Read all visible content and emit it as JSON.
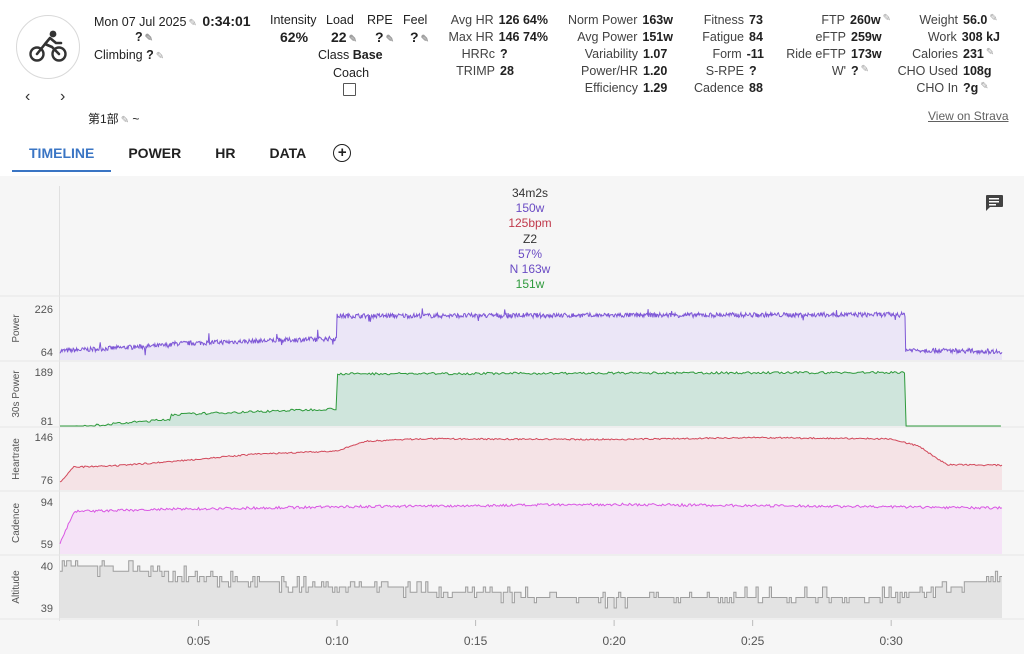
{
  "activity": {
    "date": "Mon 07 Jul 2025",
    "duration": "0:34:01",
    "name_value": "?",
    "climbing_label": "Climbing",
    "climbing_value": "?",
    "name_sub": "第1部",
    "name_sub_suffix": "~",
    "icon": "cycling-icon"
  },
  "metrics": {
    "intensity_label": "Intensity",
    "intensity": "62%",
    "load_label": "Load",
    "load": "22",
    "rpe_label": "RPE",
    "rpe": "?",
    "feel_label": "Feel",
    "feel": "?",
    "class_label": "Class",
    "class_value": "Base",
    "coach_label": "Coach"
  },
  "hr_stats": [
    {
      "label": "Avg HR",
      "value": "126  64%"
    },
    {
      "label": "Max HR",
      "value": "146  74%"
    },
    {
      "label": "HRRc",
      "value": "?"
    },
    {
      "label": "TRIMP",
      "value": "28"
    }
  ],
  "power_stats": [
    {
      "label": "Norm Power",
      "value": "163w"
    },
    {
      "label": "Avg Power",
      "value": "151w"
    },
    {
      "label": "Variability",
      "value": "1.07"
    },
    {
      "label": "Power/HR",
      "value": "1.20"
    },
    {
      "label": "Efficiency",
      "value": "1.29"
    }
  ],
  "fitness_stats": [
    {
      "label": "Fitness",
      "value": "73"
    },
    {
      "label": "Fatigue",
      "value": "84"
    },
    {
      "label": "Form",
      "value": "-11"
    },
    {
      "label": "S-RPE",
      "value": "?"
    },
    {
      "label": "Cadence",
      "value": "88"
    }
  ],
  "ftp_stats": [
    {
      "label": "FTP",
      "value": "260w"
    },
    {
      "label": "eFTP",
      "value": "259w"
    },
    {
      "label": "Ride eFTP",
      "value": "173w"
    },
    {
      "label": "W'",
      "value": "?"
    }
  ],
  "body_stats": [
    {
      "label": "Weight",
      "value": "56.0"
    },
    {
      "label": "Work",
      "value": "308 kJ"
    },
    {
      "label": "Calories",
      "value": "231"
    },
    {
      "label": "CHO Used",
      "value": "108g"
    },
    {
      "label": "CHO In",
      "value": "?g"
    }
  ],
  "strava_link": "View on Strava",
  "tabs": [
    {
      "label": "TIMELINE",
      "active": true
    },
    {
      "label": "POWER",
      "active": false
    },
    {
      "label": "HR",
      "active": false
    },
    {
      "label": "DATA",
      "active": false
    }
  ],
  "add_tab": "+",
  "summary": {
    "duration": "34m2s",
    "power": "150w",
    "hr": "125bpm",
    "zone": "Z2",
    "percent": "57%",
    "norm_power": "N 163w",
    "avg_power": "151w"
  },
  "colors": {
    "power": "#7e57d6",
    "power30": "#2e9a3c",
    "hr": "#d24a5c",
    "cadence": "#d957e3",
    "altitude": "#9e9e9e",
    "accent": "#3a75c4"
  },
  "chart_data": [
    {
      "type": "line",
      "ylabel": "Power",
      "yticks": [
        226,
        64
      ],
      "series": [
        {
          "name": "Power",
          "segments": [
            {
              "x": [
                0,
                4
              ],
              "y": [
                68,
                90
              ]
            },
            {
              "x": [
                4,
                10
              ],
              "y": [
                95,
                115
              ]
            },
            {
              "x": [
                10,
                30.5
              ],
              "y": [
                200,
                205
              ]
            },
            {
              "x": [
                30.5,
                34
              ],
              "y": [
                72,
                66
              ]
            }
          ]
        }
      ]
    },
    {
      "type": "area",
      "ylabel": "30s Power",
      "yticks": [
        189,
        81
      ],
      "series": [
        {
          "name": "30s Power",
          "segments": [
            {
              "x": [
                0,
                4
              ],
              "y": [
                65,
                85
              ]
            },
            {
              "x": [
                4,
                10
              ],
              "y": [
                95,
                108
              ]
            },
            {
              "x": [
                10,
                30.5
              ],
              "y": [
                185,
                188
              ]
            },
            {
              "x": [
                30.5,
                34
              ],
              "y": [
                66,
                64
              ]
            }
          ]
        }
      ]
    },
    {
      "type": "area",
      "ylabel": "Heartrate",
      "yticks": [
        146,
        76
      ],
      "series": [
        {
          "name": "Heartrate",
          "points": [
            [
              0,
              72
            ],
            [
              0.5,
              97
            ],
            [
              2,
              99
            ],
            [
              4,
              106
            ],
            [
              7,
              118
            ],
            [
              10,
              123
            ],
            [
              11,
              139
            ],
            [
              13,
              143
            ],
            [
              20,
              142
            ],
            [
              25,
              145
            ],
            [
              30,
              143
            ],
            [
              31,
              131
            ],
            [
              32,
              101
            ],
            [
              34,
              100
            ]
          ]
        }
      ]
    },
    {
      "type": "area",
      "ylabel": "Cadence",
      "yticks": [
        94,
        59
      ],
      "series": [
        {
          "name": "Cadence",
          "points": [
            [
              0,
              59
            ],
            [
              0.5,
              86
            ],
            [
              4,
              88
            ],
            [
              10,
              90
            ],
            [
              15,
              91
            ],
            [
              20,
              92
            ],
            [
              25,
              91
            ],
            [
              30,
              90
            ],
            [
              34,
              89
            ]
          ]
        }
      ]
    },
    {
      "type": "area",
      "ylabel": "Altitude",
      "yticks": [
        40,
        39
      ],
      "series": [
        {
          "name": "Altitude",
          "points": [
            [
              0,
              40
            ],
            [
              3,
              39.9
            ],
            [
              7,
              39.6
            ],
            [
              10,
              39.5
            ],
            [
              14,
              39.4
            ],
            [
              20,
              39.2
            ],
            [
              25,
              39.3
            ],
            [
              30,
              39.3
            ],
            [
              32,
              39.5
            ],
            [
              34,
              39.7
            ]
          ]
        }
      ]
    },
    {
      "type": "axis",
      "xlabel": "",
      "x_ticks": [
        "0:05",
        "0:10",
        "0:15",
        "0:20",
        "0:25",
        "0:30"
      ],
      "x_tick_values": [
        5,
        10,
        15,
        20,
        25,
        30
      ],
      "xlim": [
        0,
        34
      ]
    }
  ]
}
